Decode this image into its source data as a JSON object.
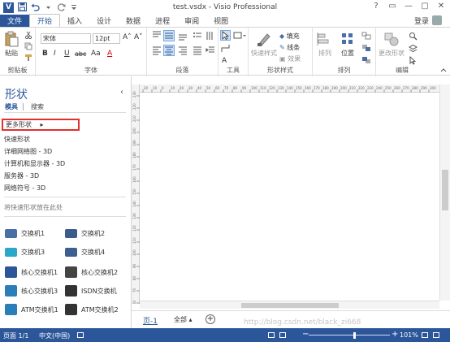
{
  "window": {
    "title": "test.vsdx - Visio Professional",
    "app_icon": "V",
    "buttons": [
      "?",
      "▭",
      "—",
      "▢",
      "✕"
    ]
  },
  "quick_access": {
    "save_icon": "save-icon",
    "undo_icon": "undo-icon",
    "redo_icon": "redo-icon"
  },
  "tabs": {
    "file": "文件",
    "items": [
      "开始",
      "插入",
      "设计",
      "数据",
      "进程",
      "审阅",
      "视图"
    ],
    "active": "开始"
  },
  "account": {
    "login": "登录"
  },
  "ribbon": {
    "clipboard": {
      "label": "剪贴板",
      "paste": "粘贴"
    },
    "font": {
      "label": "字体",
      "family": "宋体",
      "size": "12pt",
      "bold": "B",
      "italic": "I",
      "underline": "U",
      "strike": "abc",
      "case": "Aa",
      "color": "A",
      "grow": "A˄",
      "shrink": "A˅"
    },
    "paragraph": {
      "label": "段落"
    },
    "tools": {
      "label": "工具"
    },
    "shape_styles": {
      "label": "形状样式",
      "quick_styles": "快速样式",
      "fill": "填充",
      "line": "线条",
      "effects": "效果"
    },
    "arrange": {
      "label": "排列",
      "arrange": "排列",
      "position": "位置"
    },
    "editing": {
      "label": "编辑",
      "change_shape": "更改形状"
    }
  },
  "shapes_pane": {
    "title": "形状",
    "collapse": "‹",
    "tab_stencils": "模具",
    "tab_search": "搜索",
    "more_shapes": "更多形状",
    "more_arrow": "▸",
    "stencils": [
      "快速形状",
      "详细网络图 - 3D",
      "计算机和显示器 - 3D",
      "服务器 - 3D",
      "网络符号 - 3D"
    ],
    "drop_hint": "将快速形状放在此处",
    "shapes": [
      {
        "name": "交换机1",
        "color": "#4a6fa5"
      },
      {
        "name": "交换机2",
        "color": "#3d5c8a"
      },
      {
        "name": "交换机3",
        "color": "#2aa7c9"
      },
      {
        "name": "交换机4",
        "color": "#3c5f8f"
      },
      {
        "name": "核心交换机1",
        "color": "#2b579a"
      },
      {
        "name": "核心交换机2",
        "color": "#444444"
      },
      {
        "name": "核心交换机3",
        "color": "#2a7fb8"
      },
      {
        "name": "ISDN交换机",
        "color": "#333333"
      },
      {
        "name": "ATM交换机1",
        "color": "#2a7fb8"
      },
      {
        "name": "ATM交换机2",
        "color": "#333333"
      }
    ]
  },
  "ruler": {
    "top_ticks": [
      "20",
      "10",
      "0",
      "10",
      "20",
      "30",
      "40",
      "50",
      "60",
      "70",
      "80",
      "90",
      "100",
      "110",
      "120",
      "130",
      "140",
      "150",
      "160",
      "170",
      "180",
      "190",
      "200",
      "210",
      "220",
      "230",
      "240",
      "250",
      "260",
      "270",
      "280",
      "290",
      "300"
    ],
    "left_ticks": [
      "230",
      "220",
      "210",
      "200",
      "190",
      "180",
      "170",
      "160",
      "150",
      "140",
      "130",
      "120",
      "110",
      "100",
      "90",
      "80",
      "70",
      "60"
    ]
  },
  "page_bar": {
    "page_tab": "页-1",
    "all_pages": "全部 ▴",
    "add_page": "+"
  },
  "status": {
    "page": "页面 1/1",
    "language": "中文(中国)",
    "zoom": "101%",
    "zoom_level": 0.56
  },
  "watermark": "http://blog.csdn.net/black_zi668"
}
